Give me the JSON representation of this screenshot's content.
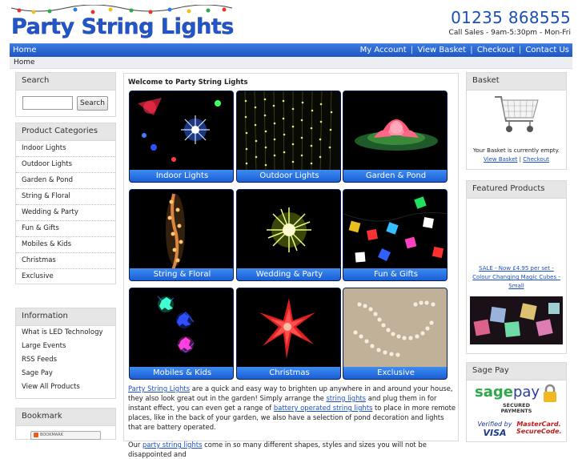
{
  "header": {
    "logo_text": "Party String Lights",
    "phone": "01235 868555",
    "hours": "Call Sales - 9am-5:30pm - Mon-Fri"
  },
  "nav": {
    "home": "Home",
    "right_links": [
      "My Account",
      "View Basket",
      "Checkout",
      "Contact Us"
    ],
    "separator": "|"
  },
  "breadcrumb": "Home",
  "search": {
    "title": "Search",
    "button": "Search",
    "value": ""
  },
  "categories": {
    "title": "Product Categories",
    "items": [
      "Indoor Lights",
      "Outdoor Lights",
      "Garden & Pond",
      "String & Floral",
      "Wedding & Party",
      "Fun & Gifts",
      "Mobiles & Kids",
      "Christmas",
      "Exclusive"
    ]
  },
  "information": {
    "title": "Information",
    "items": [
      "What is LED Technology",
      "Large Events",
      "RSS Feeds",
      "Sage Pay",
      "View All Products"
    ]
  },
  "bookmark": {
    "title": "Bookmark",
    "button": "BOOKMARK"
  },
  "main": {
    "welcome": "Welcome to Party String Lights",
    "tiles": [
      "Indoor Lights",
      "Outdoor Lights",
      "Garden & Pond",
      "String & Floral",
      "Wedding & Party",
      "Fun & Gifts",
      "Mobiles & Kids",
      "Christmas",
      "Exclusive"
    ],
    "intro1_link1": "Party String Lights",
    "intro1_a": " are a quick and easy way to brighten up anywhere in and around your house, they also look great out in the garden! Simply arrange the ",
    "intro1_link2": "string lights",
    "intro1_b": " and plug them in for instant effect, you can even get a range of ",
    "intro1_link3": "battery operated string lights",
    "intro1_c": " to place in more remote places, like in the back of your garden, we also have a selection of pond decoration and lights that are battery operated.",
    "intro2_a": "Our ",
    "intro2_link": "party string lights",
    "intro2_b": " come in so many different shapes, styles and sizes you will not be disappointed and"
  },
  "basket": {
    "title": "Basket",
    "status": "Your Basket is currently empty.",
    "view": "View Basket",
    "sep": "|",
    "checkout": "Checkout"
  },
  "featured": {
    "title": "Featured Products",
    "product_link": "SALE - Now £4.95 per set - Colour Changing Magic Cubes - Small"
  },
  "sagepay": {
    "title": "Sage Pay",
    "logo_sage": "sage",
    "logo_pay": "pay",
    "secured": "SECURED PAYMENTS",
    "verified": "Verified by",
    "visa": "VISA",
    "mastercard": "MasterCard.",
    "securecode": "SecureCode."
  },
  "colors": {
    "brand_blue": "#2255c8",
    "nav_blue": "#1f56c2",
    "tile_label_blue": "#1a5ed6",
    "link_blue": "#1a4fc8"
  }
}
